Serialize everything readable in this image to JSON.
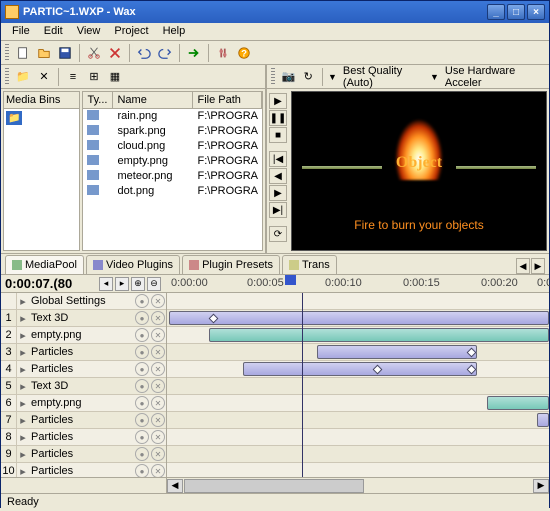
{
  "window": {
    "title": "PARTIC~1.WXP - Wax"
  },
  "menu": [
    "File",
    "Edit",
    "View",
    "Project",
    "Help"
  ],
  "media_bins_label": "Media Bins",
  "file_cols": {
    "type": "Ty...",
    "name": "Name",
    "path": "File Path"
  },
  "files": [
    {
      "name": "rain.png",
      "path": "F:\\PROGRA"
    },
    {
      "name": "spark.png",
      "path": "F:\\PROGRA"
    },
    {
      "name": "cloud.png",
      "path": "F:\\PROGRA"
    },
    {
      "name": "empty.png",
      "path": "F:\\PROGRA"
    },
    {
      "name": "meteor.png",
      "path": "F:\\PROGRA"
    },
    {
      "name": "dot.png",
      "path": "F:\\PROGRA"
    }
  ],
  "preview": {
    "quality": "Best Quality (Auto)",
    "hw": "Use Hardware Acceler",
    "object_text": "Object",
    "caption": "Fire to burn your objects"
  },
  "tabs": [
    "MediaPool",
    "Video Plugins",
    "Plugin Presets",
    "Trans"
  ],
  "timecode": "0:00:07.(80",
  "ruler": [
    "0:00:00",
    "0:00:05",
    "0:00:10",
    "0:00:15",
    "0:00:20",
    "0:0"
  ],
  "tracks": [
    {
      "num": "",
      "name": "Global Settings",
      "exp": "▸"
    },
    {
      "num": "1",
      "name": "Text 3D",
      "exp": "▸"
    },
    {
      "num": "2",
      "name": "empty.png",
      "exp": "▸"
    },
    {
      "num": "3",
      "name": "Particles",
      "exp": "▸"
    },
    {
      "num": "4",
      "name": "Particles",
      "exp": "▸"
    },
    {
      "num": "5",
      "name": "Text 3D",
      "exp": "▸"
    },
    {
      "num": "6",
      "name": "empty.png",
      "exp": "▸"
    },
    {
      "num": "7",
      "name": "Particles",
      "exp": "▸"
    },
    {
      "num": "8",
      "name": "Particles",
      "exp": "▸"
    },
    {
      "num": "9",
      "name": "Particles",
      "exp": "▸"
    },
    {
      "num": "10",
      "name": "Particles",
      "exp": "▸"
    }
  ],
  "status": "Ready"
}
